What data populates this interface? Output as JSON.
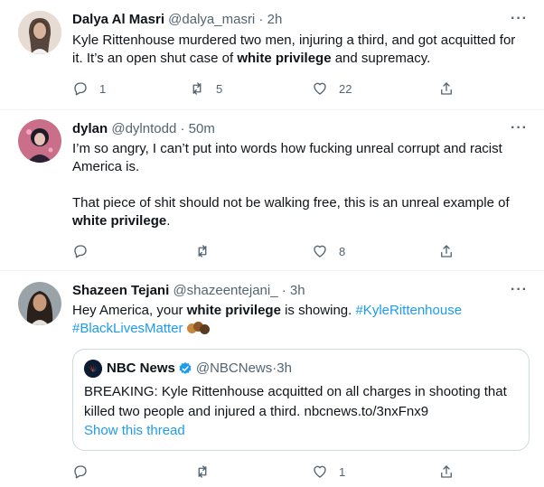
{
  "tweets": [
    {
      "name": "Dalya Al Masri",
      "handle": "@dalya_masri",
      "time": "2h",
      "text_parts": [
        {
          "t": "Kyle Rittenhouse murdered two men, injuring a third, and got acquitted for it. It’s an open shut case of "
        },
        {
          "b": "white privilege"
        },
        {
          "t": " and supremacy."
        }
      ],
      "replies": "1",
      "retweets": "5",
      "likes": "22"
    },
    {
      "name": "dylan",
      "handle": "@dylntodd",
      "time": "50m",
      "para1": "I’m so angry, I can’t put into words how fucking unreal corrupt and racist America is.",
      "para2_pre": "That piece of shit should not be walking free, this is an unreal example of ",
      "para2_bold": "white privilege",
      "para2_post": ".",
      "replies": "",
      "retweets": "",
      "likes": "8"
    },
    {
      "name": "Shazeen Tejani",
      "handle": "@shazeentejani_",
      "time": "3h",
      "pre": "Hey America, your ",
      "bold": "white privilege",
      "post": " is showing. ",
      "hashtag1": "#KyleRittenhouse",
      "hashtag2": "#BlackLivesMatter",
      "replies": "",
      "retweets": "",
      "likes": "1",
      "quote": {
        "name": "NBC News",
        "handle": "@NBCNews",
        "time": "3h",
        "text_pre": "BREAKING: Kyle Rittenhouse acquitted on all charges in shooting that killed two people and injured a third. ",
        "text_link": "nbcnews.to/3nxFnx9",
        "show_thread": "Show this thread"
      }
    }
  ],
  "separator": " · ",
  "more_label": "···",
  "colors": {
    "link": "#1d9bf0",
    "secondary": "#536471",
    "border": "#eff3f4",
    "quote_border": "#cfd9de"
  }
}
